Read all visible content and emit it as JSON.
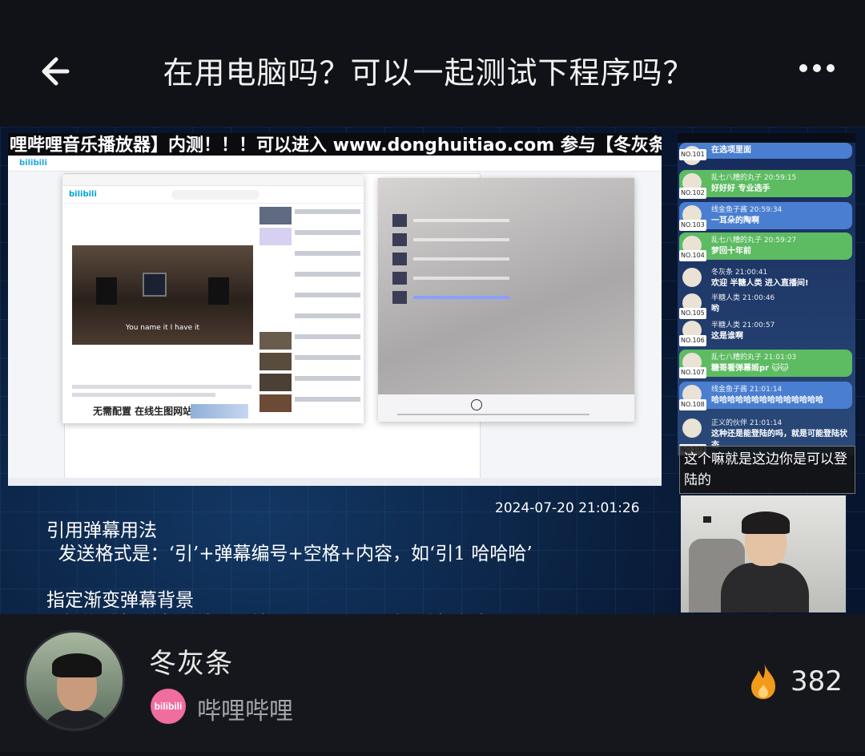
{
  "header": {
    "title": "在用电脑吗？可以一起测试下程序吗？",
    "back_icon": "back-arrow-icon",
    "more_icon": "more-dots-icon"
  },
  "stream": {
    "banner": "哩哔哩音乐播放器】内测！！！可以进入 www.donghuitiao.com 参与【冬灰条哔哩",
    "video_caption": "You name it I have it",
    "ad_text": "无需配置 在线生图网站",
    "timestamp": "2024-07-20 21:01:26",
    "info_lines": [
      "引用弹幕用法",
      "  发送格式是：‘引’+弹幕编号+空格+内容，如‘引1 哈哈哈’",
      "",
      "指定渐变弹幕背景",
      "  发送‘随机渐变’+编号，编号是 0~249，如‘随机渐变001’"
    ]
  },
  "danmaku": [
    {
      "no": "NO.101",
      "name": "",
      "text": "在选项里面",
      "style": "blue"
    },
    {
      "no": "NO.102",
      "name": "乱七八糟的丸子 20:59:15",
      "text": "好好好 专业选手",
      "style": "green"
    },
    {
      "no": "NO.103",
      "name": "线金鱼子酱 20:59:34",
      "text": "一耳朵的陶啊",
      "style": "blue"
    },
    {
      "no": "NO.104",
      "name": "乱七八糟的丸子 20:59:27",
      "text": "梦回十年前",
      "style": "green"
    },
    {
      "no": "",
      "name": "冬灰条 21:00:41",
      "text": "欢迎 半糖人类 进入直播间!",
      "style": "dark"
    },
    {
      "no": "NO.105",
      "name": "半糖人类 21:00:46",
      "text": "哟",
      "style": "dark"
    },
    {
      "no": "NO.106",
      "name": "半糖人类 21:00:57",
      "text": "这是谁啊",
      "style": "dark"
    },
    {
      "no": "NO.107",
      "name": "乱七八糟的丸子 21:01:03",
      "text": "糖哥看弹幕姬pr 🐱🐱",
      "style": "green"
    },
    {
      "no": "NO.108",
      "name": "线金鱼子酱 21:01:14",
      "text": "哈哈哈哈哈哈哈哈哈哈哈哈哈哈",
      "style": "blue"
    },
    {
      "no": "NO.109",
      "name": "正义的伙伴 21:01:14",
      "text": "这种还是能登陆的吗，就是可能登陆状态",
      "style": "dark"
    }
  ],
  "subtitle": "这个嘛就是这边你是可以登陆的",
  "footer": {
    "streamer_name": "冬灰条",
    "platform": "哔哩哔哩",
    "platform_badge": "bilibili",
    "heat": "382",
    "fire_icon": "fire-icon"
  },
  "colors": {
    "background": "#111217",
    "danmaku_blue": "#4a7ed0",
    "danmaku_green": "#5dbb62",
    "bili_pink": "#f06da0",
    "fire_orange": "#f29a1b"
  }
}
